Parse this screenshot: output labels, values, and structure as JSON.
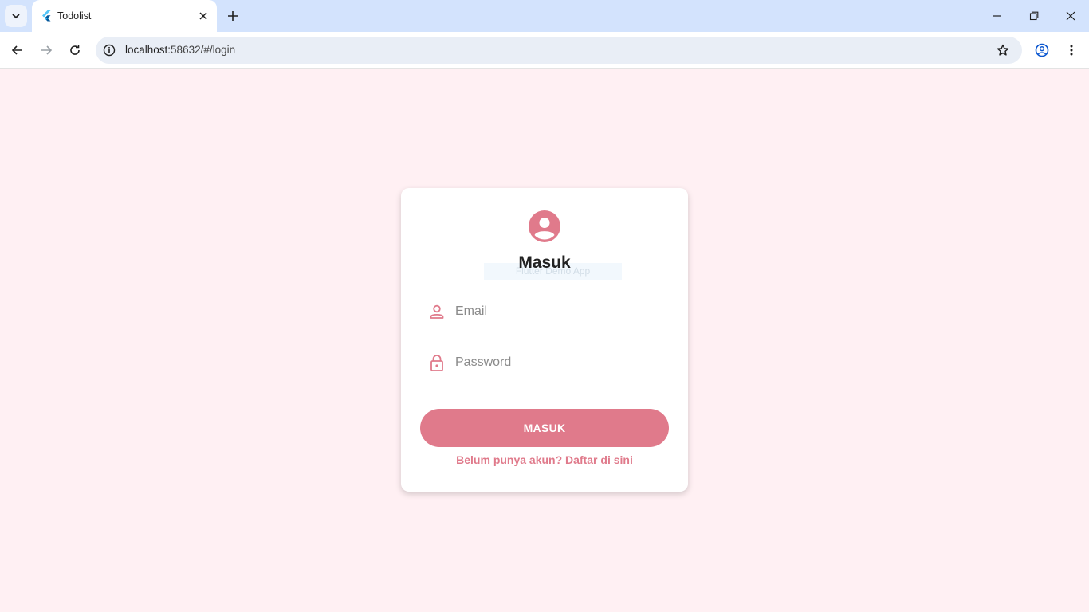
{
  "browser": {
    "tab_title": "Todolist",
    "url_host": "localhost",
    "url_rest": ":58632/#/login"
  },
  "login": {
    "heading": "Masuk",
    "ghost_text": "Flutter Demo App",
    "email_placeholder": "Email",
    "password_placeholder": "Password",
    "submit_label": "MASUK",
    "register_link": "Belum punya akun? Daftar di sini"
  },
  "colors": {
    "accent": "#e07a8b",
    "page_background": "#fff0f3"
  },
  "icons": {
    "avatar": "account-circle-icon",
    "email": "person-icon",
    "password": "lock-icon"
  }
}
